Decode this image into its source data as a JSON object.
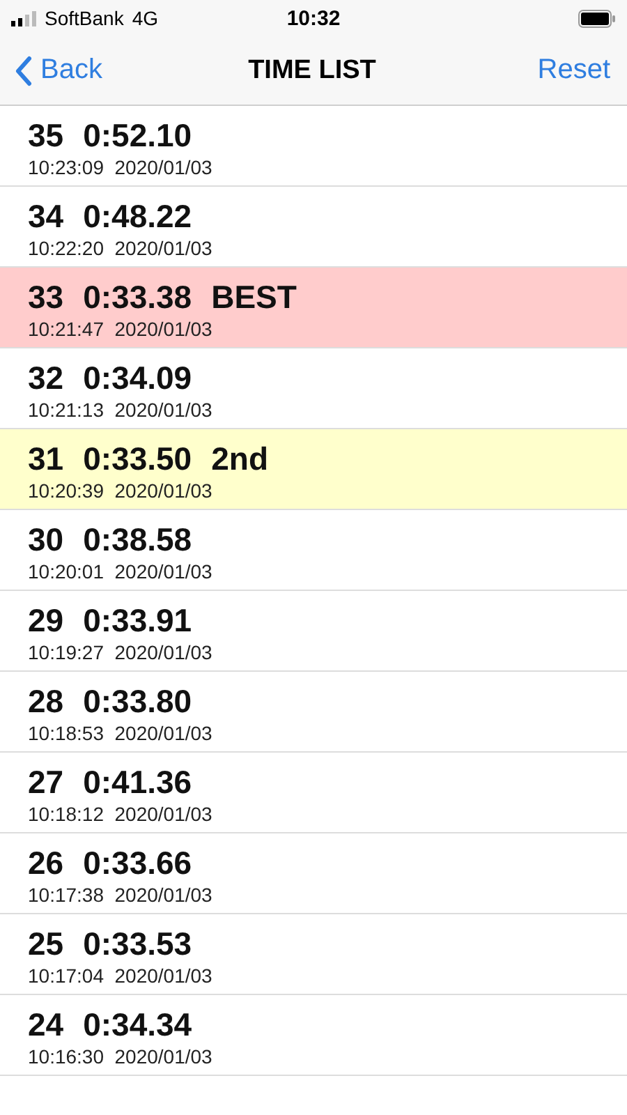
{
  "status_bar": {
    "carrier": "SoftBank",
    "network": "4G",
    "time": "10:32"
  },
  "nav_bar": {
    "back": "Back",
    "title": "TIME LIST",
    "action": "Reset"
  },
  "rows": [
    {
      "number": "35",
      "time": "0:52.10",
      "timestamp": "10:23:09  2020/01/03",
      "kind": "plain"
    },
    {
      "number": "34",
      "time": "0:48.22",
      "timestamp": "10:22:20  2020/01/03",
      "kind": "plain"
    },
    {
      "number": "33",
      "time": "0:33.38",
      "tag": "BEST",
      "timestamp": "10:21:47  2020/01/03",
      "kind": "best"
    },
    {
      "number": "32",
      "time": "0:34.09",
      "timestamp": "10:21:13  2020/01/03",
      "kind": "plain"
    },
    {
      "number": "31",
      "time": "0:33.50",
      "tag": "2nd",
      "timestamp": "10:20:39  2020/01/03",
      "kind": "second"
    },
    {
      "number": "30",
      "time": "0:38.58",
      "timestamp": "10:20:01  2020/01/03",
      "kind": "plain"
    },
    {
      "number": "29",
      "time": "0:33.91",
      "timestamp": "10:19:27  2020/01/03",
      "kind": "plain"
    },
    {
      "number": "28",
      "time": "0:33.80",
      "timestamp": "10:18:53  2020/01/03",
      "kind": "plain"
    },
    {
      "number": "27",
      "time": "0:41.36",
      "timestamp": "10:18:12  2020/01/03",
      "kind": "plain"
    },
    {
      "number": "26",
      "time": "0:33.66",
      "timestamp": "10:17:38  2020/01/03",
      "kind": "plain"
    },
    {
      "number": "25",
      "time": "0:33.53",
      "timestamp": "10:17:04  2020/01/03",
      "kind": "plain"
    },
    {
      "number": "24",
      "time": "0:34.34",
      "timestamp": "10:16:30  2020/01/03",
      "kind": "plain"
    }
  ]
}
